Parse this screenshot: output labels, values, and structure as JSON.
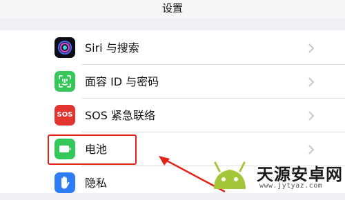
{
  "header": {
    "title": "设置"
  },
  "settings": {
    "items": [
      {
        "label": "Siri 与搜索",
        "icon": "siri-icon"
      },
      {
        "label": "面容 ID 与密码",
        "icon": "face-id-icon"
      },
      {
        "label": "SOS 紧急联络",
        "icon": "sos-icon",
        "icon_text": "SOS"
      },
      {
        "label": "电池",
        "icon": "battery-icon",
        "highlighted": true
      },
      {
        "label": "隐私",
        "icon": "privacy-hand-icon"
      }
    ]
  },
  "annotation": {
    "highlight_color": "#e2231a",
    "arrow_color": "#e2231a"
  },
  "watermark": {
    "brand": "天源安卓网",
    "url": "www.jytyaz.com"
  },
  "colors": {
    "face_id_green": "#35c759",
    "sos_red": "#e3342f",
    "battery_green": "#34c759",
    "privacy_blue": "#2e7cf6"
  }
}
